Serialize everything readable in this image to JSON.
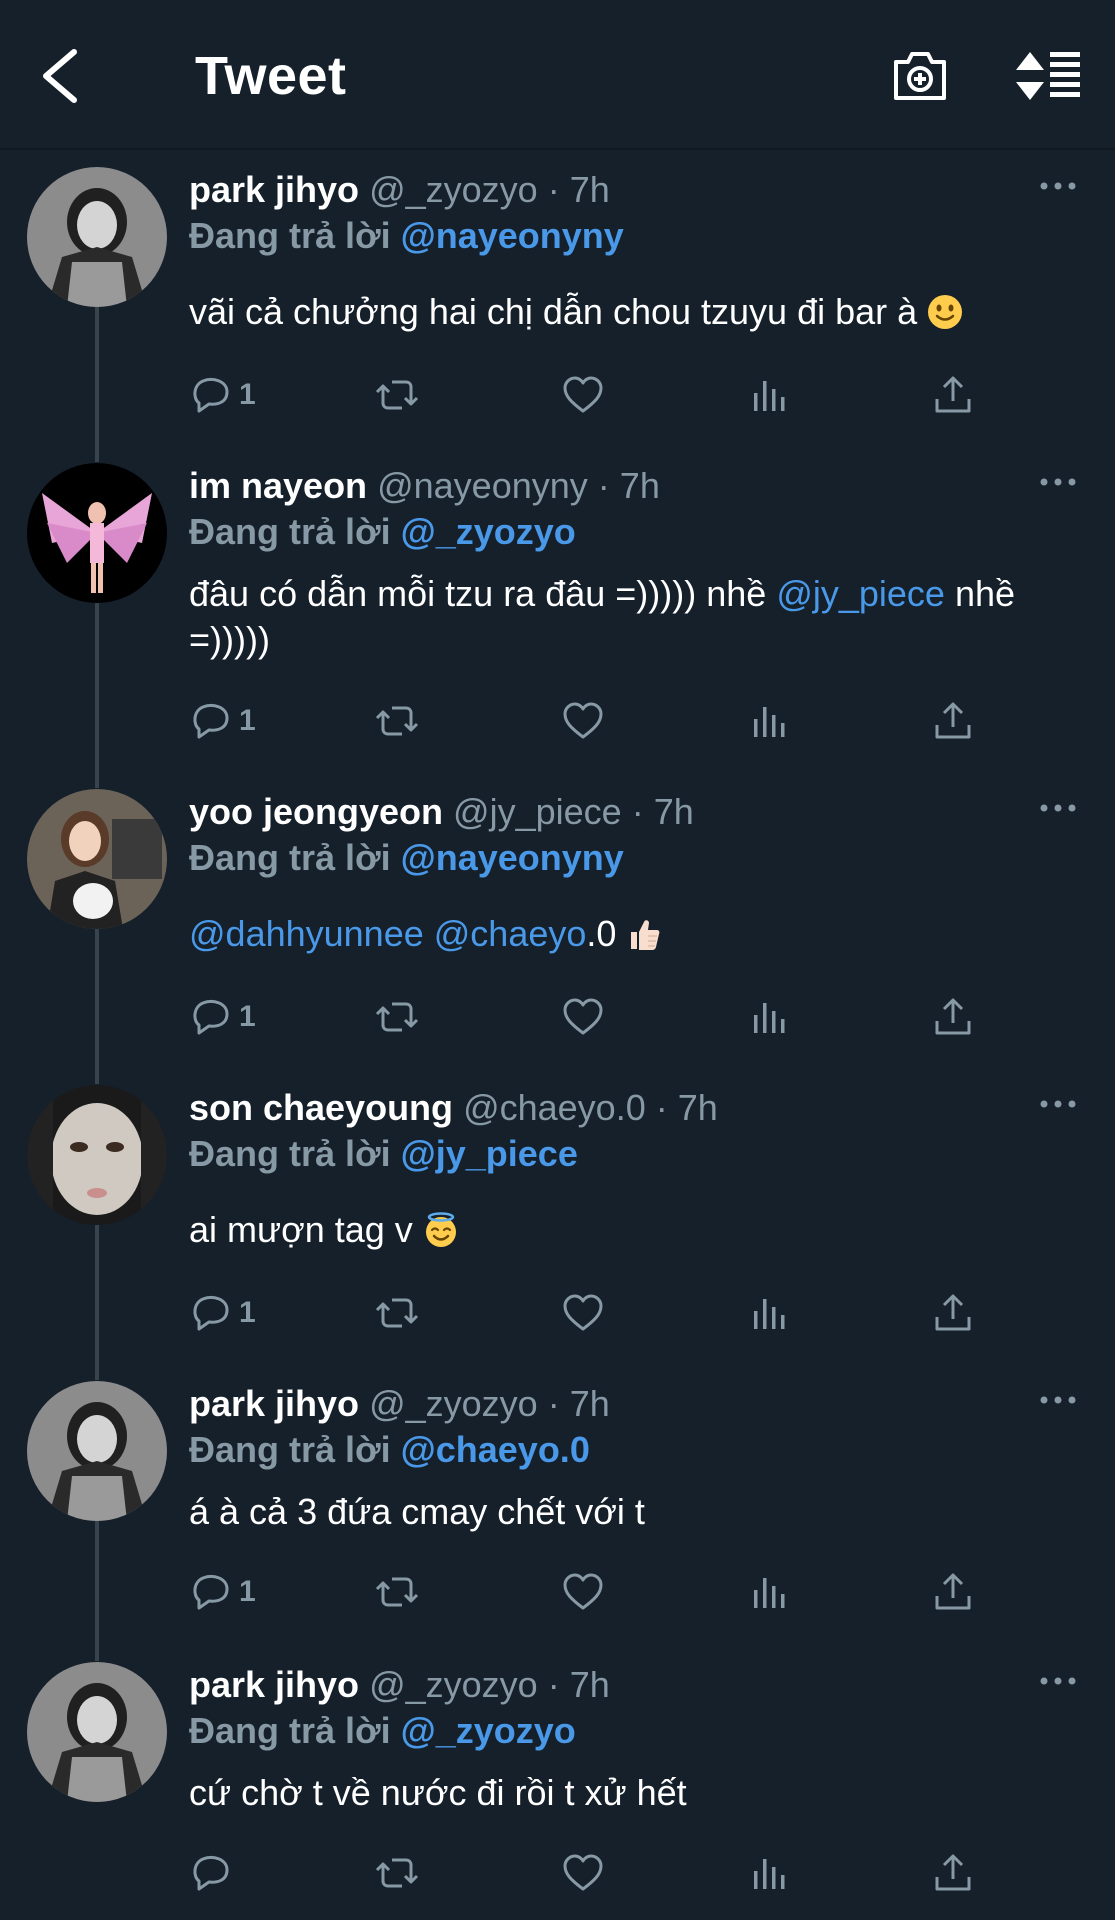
{
  "header": {
    "title": "Tweet",
    "back_icon": "chevron-left-icon",
    "camera_icon": "camera-plus-icon",
    "sort_icon": "sort-list-icon"
  },
  "colors": {
    "background": "#15202b",
    "muted": "#8899a6",
    "link": "#4a99e9",
    "divider": "#38444d"
  },
  "reply_prefix": "Đang trả lời",
  "separator": "·",
  "tweets": [
    {
      "name": "park jihyo",
      "handle": "@_zyozyo",
      "time": "7h",
      "reply_to": "@nayeonyny",
      "text_before": "vãi cả chưởng hai chị dẫn chou tzuyu đi bar à",
      "mention": "",
      "text_after": "",
      "emoji": "slightly-smiling-face",
      "reply_count": "1"
    },
    {
      "name": "im nayeon",
      "handle": "@nayeonyny",
      "time": "7h",
      "reply_to": "@_zyozyo",
      "text_before": "đâu có dẫn mỗi tzu ra đâu =))))) nhề ",
      "mention": "@jy_piece",
      "text_after": " nhề =)))))",
      "emoji": "",
      "reply_count": "1"
    },
    {
      "name": "yoo jeongyeon",
      "handle": "@jy_piece",
      "time": "7h",
      "reply_to": "@nayeonyny",
      "mention_1": "@dahhyunnee",
      "mention_2": "@chaeyo",
      "text_after": ".0",
      "emoji": "thumbs-up",
      "reply_count": "1"
    },
    {
      "name": "son chaeyoung",
      "handle": "@chaeyo.0",
      "time": "7h",
      "reply_to": "@jy_piece",
      "text_before": "ai mượn tag v",
      "emoji": "smiling-face-with-halo",
      "reply_count": "1"
    },
    {
      "name": "park jihyo",
      "handle": "@_zyozyo",
      "time": "7h",
      "reply_to": "@chaeyo.0",
      "text_before": "á à cả 3 đứa cmay chết với t",
      "emoji": "",
      "reply_count": "1"
    },
    {
      "name": "park jihyo",
      "handle": "@_zyozyo",
      "time": "7h",
      "reply_to": "@_zyozyo",
      "text_before": "cứ chờ t về nước đi rồi t xử hết",
      "emoji": "",
      "reply_count": ""
    }
  ]
}
